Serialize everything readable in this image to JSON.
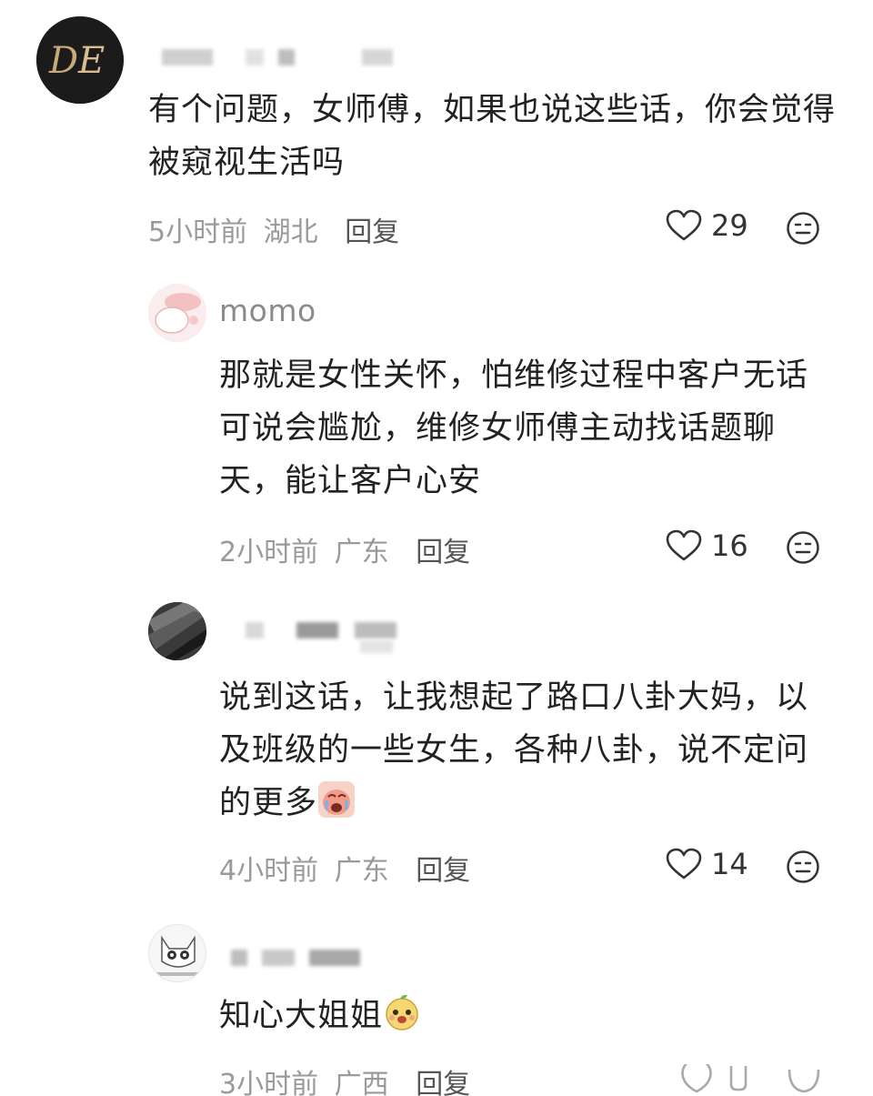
{
  "comments": [
    {
      "text": "有个问题，女师傅，如果也说这些话，你会觉得被窥视生活吗",
      "time": "5小时前",
      "location": "湖北",
      "reply_label": "回复",
      "likes": "29"
    },
    {
      "username": "momo",
      "text": "那就是女性关怀，怕维修过程中客户无话可说会尴尬，维修女师傅主动找话题聊天，能让客户心安",
      "time": "2小时前",
      "location": "广东",
      "reply_label": "回复",
      "likes": "16"
    },
    {
      "text": "说到这话，让我想起了路口八卦大妈，以及班级的一些女生，各种八卦，说不定问的更多",
      "time": "4小时前",
      "location": "广东",
      "reply_label": "回复",
      "likes": "14"
    },
    {
      "text": "知心大姐姐",
      "time": "3小时前",
      "location": "广西",
      "reply_label": "回复"
    }
  ],
  "icons": {
    "like": "heart-outline-icon",
    "react": "neutral-face-icon",
    "crying_emoji": "crying-face-emoji",
    "smile_emoji": "smiling-face-emoji"
  },
  "colors": {
    "text": "#222222",
    "meta": "#9a9a9a",
    "username": "#8b8b8b"
  }
}
